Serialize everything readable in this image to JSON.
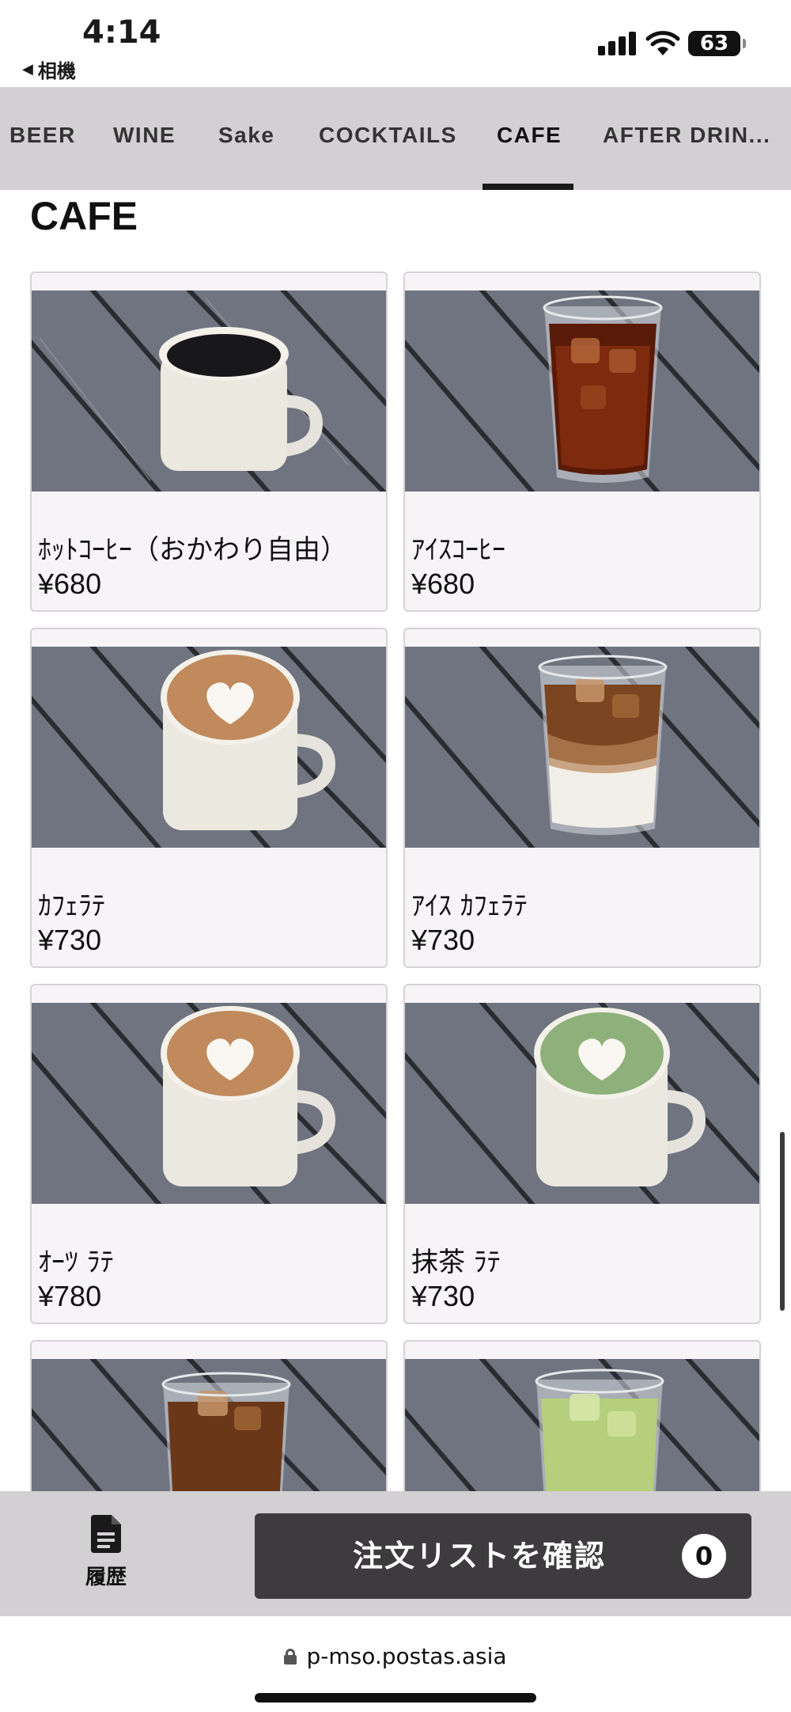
{
  "status_bar": {
    "time": "4:14",
    "back_app": "相機",
    "battery": "63"
  },
  "tabs": [
    {
      "label": "BEER",
      "active": false
    },
    {
      "label": "WINE",
      "active": false
    },
    {
      "label": "Sake",
      "active": false
    },
    {
      "label": "COCKTAILS",
      "active": false
    },
    {
      "label": "CAFE",
      "active": true
    },
    {
      "label": "AFTER DRIN...",
      "active": false
    }
  ],
  "section": {
    "title": "CAFE"
  },
  "items": [
    {
      "name": "ﾎｯﾄｺｰﾋｰ（おかわり自由）",
      "price": "¥680",
      "image": "hot-coffee-mug-photo"
    },
    {
      "name": "ｱｲｽｺｰﾋｰ",
      "price": "¥680",
      "image": "iced-coffee-glass-photo"
    },
    {
      "name": "ｶﾌｪﾗﾃ",
      "price": "¥730",
      "image": "cafe-latte-mug-photo"
    },
    {
      "name": "ｱｲｽ ｶﾌｪﾗﾃ",
      "price": "¥730",
      "image": "iced-latte-glass-photo"
    },
    {
      "name": "ｵｰﾂ ﾗﾃ",
      "price": "¥780",
      "image": "oat-latte-mug-photo"
    },
    {
      "name": "抹茶 ﾗﾃ",
      "price": "¥730",
      "image": "matcha-latte-mug-photo"
    },
    {
      "name": "",
      "price": "",
      "image": "iced-latte-glass-photo"
    },
    {
      "name": "",
      "price": "",
      "image": "iced-matcha-latte-glass-photo"
    }
  ],
  "bottom_bar": {
    "history_label": "履歴",
    "order_button_label": "注文リストを確認",
    "order_count": "0"
  },
  "browser": {
    "url": "p-mso.postas.asia"
  },
  "colors": {
    "tab_bar_bg": "#d3d0d3",
    "card_bg": "#f7f4f8",
    "order_button_bg": "#3d3b3d"
  }
}
